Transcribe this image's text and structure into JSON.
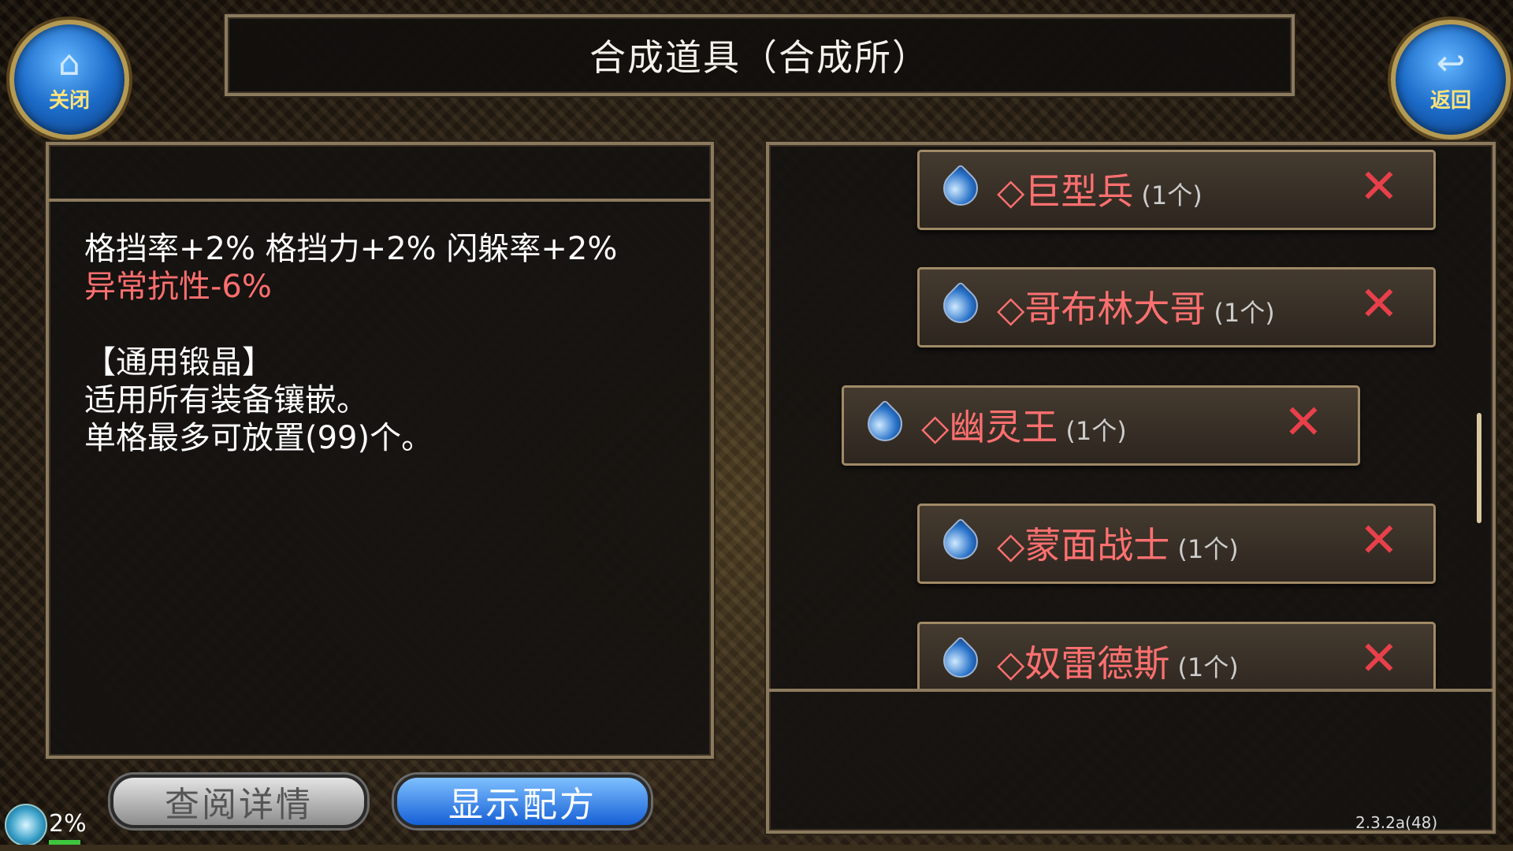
{
  "title": "合成道具（合成所）",
  "close_button": {
    "icon": "home-icon",
    "label": "关闭"
  },
  "back_button": {
    "icon": "return-arrow-icon",
    "label": "返回"
  },
  "description": {
    "stats": "格挡率+2% 格挡力+2% 闪躲率+2%",
    "negative": "异常抗性-6%",
    "category": "【通用锻晶】",
    "line1": "适用所有装备镶嵌。",
    "line2": "单格最多可放置(99)个。"
  },
  "buttons": {
    "detail": "查阅详情",
    "formula": "显示配方"
  },
  "items": [
    {
      "name": "◇巨型兵",
      "qty": "(1个)"
    },
    {
      "name": "◇哥布林大哥",
      "qty": "(1个)"
    },
    {
      "name": "◇幽灵王",
      "qty": "(1个)"
    },
    {
      "name": "◇蒙面战士",
      "qty": "(1个)"
    },
    {
      "name": "◇奴雷德斯",
      "qty": "(1个)"
    }
  ],
  "remove_symbol": "✕",
  "status": {
    "progress": "2%",
    "version": "2.3.2a(48)"
  },
  "colors": {
    "negative_stat": "#ff6f6f",
    "item_name": "#ff7070",
    "remove": "#e8404a",
    "primary_button": "#1560d6"
  }
}
